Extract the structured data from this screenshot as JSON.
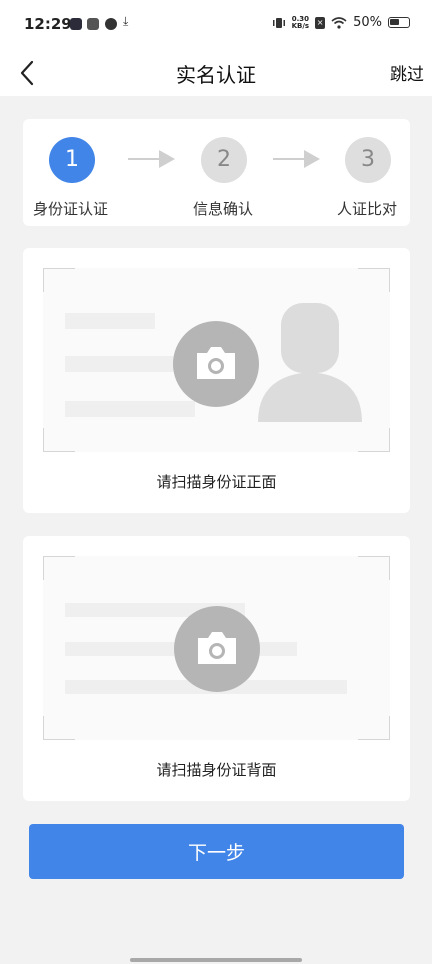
{
  "status_bar": {
    "time": "12:29",
    "net_speed_value": "0.30",
    "net_speed_unit": "KB/s",
    "battery": "50%"
  },
  "nav": {
    "title": "实名认证",
    "skip_label": "跳过"
  },
  "steps": [
    {
      "number": "1",
      "label": "身份证认证",
      "active": true
    },
    {
      "number": "2",
      "label": "信息确认",
      "active": false
    },
    {
      "number": "3",
      "label": "人证比对",
      "active": false
    }
  ],
  "front_card": {
    "caption": "请扫描身份证正面"
  },
  "back_card": {
    "caption": "请扫描身份证背面"
  },
  "next_button": {
    "label": "下一步"
  },
  "colors": {
    "accent": "#4285e8",
    "inactive_step": "#dedede",
    "background": "#f2f2f2"
  }
}
